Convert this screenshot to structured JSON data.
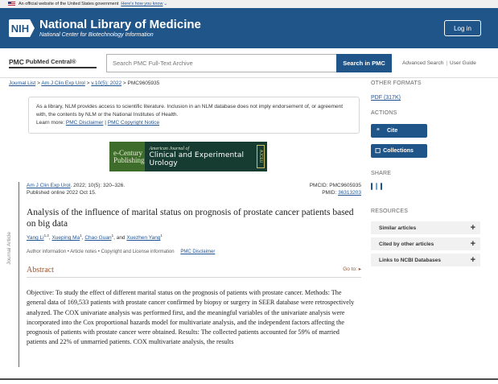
{
  "gov_banner": {
    "text": "An official website of the United States government",
    "link": "Here's how you know"
  },
  "header": {
    "logo": "NIH",
    "title": "National Library of Medicine",
    "subtitle": "National Center for Biotechnology Information",
    "login": "Log in"
  },
  "pmc_bar": {
    "logo_badge": "PMC",
    "logo_text": "PubMed Central®",
    "search_placeholder": "Search PMC Full-Text Archive",
    "search_button": "Search in PMC",
    "advanced": "Advanced Search",
    "guide": "User Guide"
  },
  "breadcrumb": {
    "journal_list": "Journal List",
    "sep1": ">",
    "journal": "Am J Clin Exp Urol",
    "sep2": ">",
    "volume": "v.10(5); 2022",
    "sep3": ">",
    "current": "PMC9605935"
  },
  "disclaimer": {
    "line1": "As a library, NLM provides access to scientific literature. Inclusion in an NLM database does not imply endorsement of, or agreement with, the contents by NLM or the National Institutes of Health.",
    "learn_more": "Learn more:",
    "link1": "PMC Disclaimer",
    "sep": "|",
    "link2": "PMC Copyright Notice"
  },
  "journal_banner": {
    "left1": "e-Century",
    "left2": "Publishing",
    "small": "American Journal of",
    "big": "Clinical and Experimental Urology",
    "side": "AJCEU"
  },
  "article": {
    "side_label": "Journal Article",
    "journal_short": "Am J Clin Exp Urol",
    "citation": ". 2022; 10(5): 320–326.",
    "published": "Published online 2022 Oct 15.",
    "pmcid": "PMCID: PMC9605935",
    "pmid_label": "PMID: ",
    "pmid": "36313203",
    "title": "Analysis of the influence of marital status on prognosis of prostate cancer patients based on big data",
    "authors": [
      {
        "name": "Yang Li",
        "sup": "1,2"
      },
      {
        "name": "Xueping Ma",
        "sup": "1"
      },
      {
        "name": "Chao Guan",
        "sup": "1"
      },
      {
        "name": "Xuezhen Yang",
        "sup": "1"
      }
    ],
    "and": "and",
    "info_row": "Author information • Article notes • Copyright and License information",
    "pmc_disclaimer": "PMC Disclaimer",
    "abstract_heading": "Abstract",
    "goto": "Go to: ▸",
    "abstract_text": "Objective: To study the effect of different marital status on the prognosis of patients with prostate cancer. Methods: The general data of 169,533 patients with prostate cancer confirmed by biopsy or surgery in SEER database were retrospectively analyzed. The COX univariate analysis was performed first, and the meaningful variables of the univariate analysis were incorporated into the Cox proportional hazards model for multivariate analysis, and the independent factors affecting the prognosis of patients with prostate cancer were obtained. Results: The collected patients accounted for 59% of married patients and 22% of unmarried patients. COX multivariate analysis, the results"
  },
  "sidebar": {
    "other_formats": "OTHER FORMATS",
    "pdf": "PDF (317K)",
    "actions": "ACTIONS",
    "cite_icon": "“",
    "cite": "Cite",
    "collections_icon": "☐",
    "collections": "Collections",
    "share": "SHARE",
    "resources": "RESOURCES",
    "resource_items": [
      "Similar articles",
      "Cited by other articles",
      "Links to NCBI Databases"
    ],
    "plus": "+"
  }
}
